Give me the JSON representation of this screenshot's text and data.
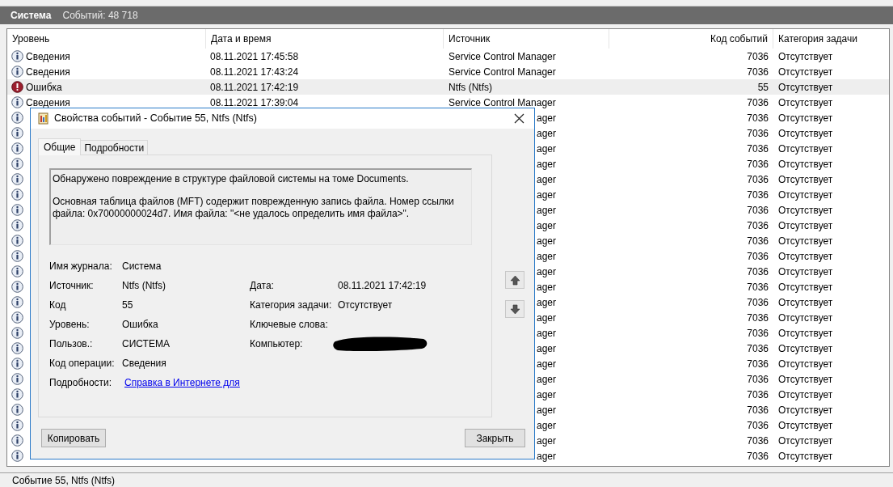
{
  "header": {
    "title": "Система",
    "count": "Событий: 48 718"
  },
  "table": {
    "columns": [
      "Уровень",
      "Дата и время",
      "Источник",
      "Код событий",
      "Категория задачи"
    ],
    "rows": [
      {
        "kind": "info",
        "covered": false,
        "selected": false,
        "level": "Сведения",
        "datetime": "08.11.2021 17:45:58",
        "source": "Service Control Manager",
        "code": "7036",
        "category": "Отсутствует"
      },
      {
        "kind": "info",
        "covered": false,
        "selected": false,
        "level": "Сведения",
        "datetime": "08.11.2021 17:43:24",
        "source": "Service Control Manager",
        "code": "7036",
        "category": "Отсутствует"
      },
      {
        "kind": "error",
        "covered": false,
        "selected": true,
        "level": "Ошибка",
        "datetime": "08.11.2021 17:42:19",
        "source": "Ntfs (Ntfs)",
        "code": "55",
        "category": "Отсутствует"
      },
      {
        "kind": "info",
        "covered": false,
        "selected": false,
        "level": "Сведения",
        "datetime": "08.11.2021 17:39:04",
        "source": "Service Control Manager",
        "code": "7036",
        "category": "Отсутствует"
      },
      {
        "kind": "info",
        "covered": true,
        "selected": false,
        "source": "ager",
        "code": "7036",
        "category": "Отсутствует"
      },
      {
        "kind": "info",
        "covered": true,
        "selected": false,
        "source": "ager",
        "code": "7036",
        "category": "Отсутствует"
      },
      {
        "kind": "info",
        "covered": true,
        "selected": false,
        "source": "ager",
        "code": "7036",
        "category": "Отсутствует"
      },
      {
        "kind": "info",
        "covered": true,
        "selected": false,
        "source": "ager",
        "code": "7036",
        "category": "Отсутствует"
      },
      {
        "kind": "info",
        "covered": true,
        "selected": false,
        "source": "ager",
        "code": "7036",
        "category": "Отсутствует"
      },
      {
        "kind": "info",
        "covered": true,
        "selected": false,
        "source": "ager",
        "code": "7036",
        "category": "Отсутствует"
      },
      {
        "kind": "info",
        "covered": true,
        "selected": false,
        "source": "ager",
        "code": "7036",
        "category": "Отсутствует"
      },
      {
        "kind": "info",
        "covered": true,
        "selected": false,
        "source": "ager",
        "code": "7036",
        "category": "Отсутствует"
      },
      {
        "kind": "info",
        "covered": true,
        "selected": false,
        "source": "ager",
        "code": "7036",
        "category": "Отсутствует"
      },
      {
        "kind": "info",
        "covered": true,
        "selected": false,
        "source": "ager",
        "code": "7036",
        "category": "Отсутствует"
      },
      {
        "kind": "info",
        "covered": true,
        "selected": false,
        "source": "ager",
        "code": "7036",
        "category": "Отсутствует"
      },
      {
        "kind": "info",
        "covered": true,
        "selected": false,
        "source": "ager",
        "code": "7036",
        "category": "Отсутствует"
      },
      {
        "kind": "info",
        "covered": true,
        "selected": false,
        "source": "ager",
        "code": "7036",
        "category": "Отсутствует"
      },
      {
        "kind": "info",
        "covered": true,
        "selected": false,
        "source": "ager",
        "code": "7036",
        "category": "Отсутствует"
      },
      {
        "kind": "info",
        "covered": true,
        "selected": false,
        "source": "ager",
        "code": "7036",
        "category": "Отсутствует"
      },
      {
        "kind": "info",
        "covered": true,
        "selected": false,
        "source": "ager",
        "code": "7036",
        "category": "Отсутствует"
      },
      {
        "kind": "info",
        "covered": true,
        "selected": false,
        "source": "ager",
        "code": "7036",
        "category": "Отсутствует"
      },
      {
        "kind": "info",
        "covered": true,
        "selected": false,
        "source": "ager",
        "code": "7036",
        "category": "Отсутствует"
      },
      {
        "kind": "info",
        "covered": true,
        "selected": false,
        "source": "ager",
        "code": "7036",
        "category": "Отсутствует"
      },
      {
        "kind": "info",
        "covered": true,
        "selected": false,
        "source": "ager",
        "code": "7036",
        "category": "Отсутствует"
      },
      {
        "kind": "info",
        "covered": true,
        "selected": false,
        "source": "ager",
        "code": "7036",
        "category": "Отсутствует"
      },
      {
        "kind": "info",
        "covered": true,
        "selected": false,
        "source": "ager",
        "code": "7036",
        "category": "Отсутствует"
      },
      {
        "kind": "info",
        "covered": true,
        "selected": false,
        "source": "ager",
        "code": "7036",
        "category": "Отсутствует"
      }
    ]
  },
  "dialog": {
    "title": "Свойства событий - Событие 55, Ntfs (Ntfs)",
    "tabs": [
      {
        "label": "Общие",
        "selected": true
      },
      {
        "label": "Подробности",
        "selected": false
      }
    ],
    "message": [
      "Обнаружено повреждение в структуре файловой системы на томе Documents.",
      "Основная таблица файлов (MFT) содержит поврежденную запись файла.  Номер ссылки файла: 0x70000000024d7.  Имя файла: \"<не удалось определить имя файла>\"."
    ],
    "fields": [
      {
        "label": "Имя журнала:",
        "value": "Система",
        "link": false
      },
      {
        "label": "Источник:",
        "value": "Ntfs (Ntfs)",
        "link": false,
        "right_label": "Дата:",
        "right_value": "08.11.2021 17:42:19"
      },
      {
        "label": "Код",
        "value": "55",
        "link": false,
        "right_label": "Категория задачи:",
        "right_value": "Отсутствует"
      },
      {
        "label": "Уровень:",
        "value": "Ошибка",
        "link": false,
        "right_label": "Ключевые слова:"
      },
      {
        "label": "Пользов.:",
        "value": "СИСТЕМА",
        "link": false,
        "right_label": "Компьютер:",
        "right_redacted": true
      },
      {
        "label": "Код операции:",
        "value": "Сведения",
        "link": false
      },
      {
        "label": "Подробности:",
        "value": "Справка в Интернете для ",
        "link": true
      }
    ],
    "buttons": [
      "Копировать",
      "Закрыть"
    ]
  },
  "status_bar": "Событие 55, Ntfs (Ntfs)"
}
